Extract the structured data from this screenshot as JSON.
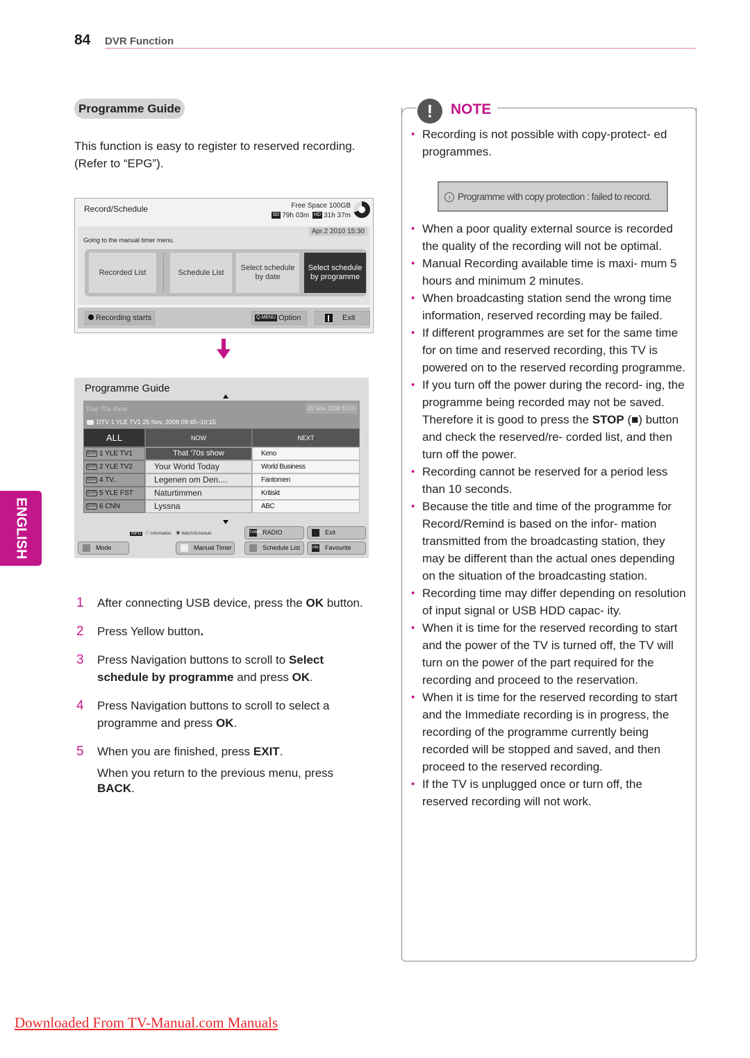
{
  "header": {
    "page_number": "84",
    "section": "DVR Function"
  },
  "language_tab": "ENGLISH",
  "left": {
    "heading": "Programme Guide",
    "intro": "This function is easy to register to reserved recording. (Refer to “EPG”)."
  },
  "record_schedule": {
    "title": "Record/Schedule",
    "free_space": "Free Space 100GB",
    "sd_badge": "SD",
    "sd_time": "79h 03m",
    "hd_badge": "HD",
    "hd_time": "31h 37m",
    "datetime": "Apr.2 2010 15:30",
    "message": "Going to the manual timer menu.",
    "tiles": [
      {
        "label": "Recorded List",
        "selected": false
      },
      {
        "label": "Schedule List",
        "selected": false
      },
      {
        "label": "Select schedule by date",
        "selected": false
      },
      {
        "label": "Select schedule by programme",
        "selected": true
      }
    ],
    "footer": {
      "record": "Recording starts",
      "qmenu_badge": "Q.MENU",
      "option": "Option",
      "exit": "Exit"
    }
  },
  "programme_guide": {
    "title": "Programme Guide",
    "current_show": "That '70s show",
    "info_date": "25 Nov. 2008 10:05",
    "channel_info": "DTV  1 YLE TV1 25 Nov. 2008 09:45~10:15",
    "columns": {
      "all": "ALL",
      "now": "NOW",
      "next": "NEXT"
    },
    "rows": [
      {
        "badge": "DTV",
        "channel": "1  YLE TV1",
        "now": "That '70s show",
        "next": "Keno",
        "selected": true
      },
      {
        "badge": "DTV",
        "channel": "2  YLE TV2",
        "now": "Your World Today",
        "next": "World Business",
        "selected": false
      },
      {
        "badge": "DTV",
        "channel": "4  TV..",
        "now": "Legenen om Den....",
        "next": "Fantomen",
        "selected": false
      },
      {
        "badge": "DTV",
        "channel": "5  YLE FST",
        "now": "Naturtimmen",
        "next": "Kritiskt",
        "selected": false
      },
      {
        "badge": "DTV",
        "channel": "6  CNN",
        "now": "Lyssna",
        "next": "ABC",
        "selected": false
      }
    ],
    "legend": {
      "info_badge": "INFO",
      "information": "Information",
      "watch": "Watch/Schedule"
    },
    "buttons": {
      "mode": "Mode",
      "manual_timer": "Manual Timer",
      "radio_badge": "TV/RAD",
      "radio": "RADIO",
      "schedule_list": "Schedule List",
      "exit": "Exit",
      "fav_badge": "FAV",
      "favourite": "Favourite"
    }
  },
  "steps": [
    {
      "num": "1",
      "pre": "After connecting USB device, press the ",
      "bold": "OK",
      "post": " button."
    },
    {
      "num": "2",
      "pre": "Press Yellow button",
      "bold": ".",
      "post": ""
    },
    {
      "num": "3",
      "pre": "Press Navigation buttons to scroll to ",
      "bold": "Select schedule by programme",
      "post": " and press ",
      "bold2": "OK",
      "post2": "."
    },
    {
      "num": "4",
      "pre": "Press Navigation buttons to scroll to select a programme and press ",
      "bold": "OK",
      "post": "."
    },
    {
      "num": "5",
      "pre": "When you are finished, press ",
      "bold": "EXIT",
      "post": "."
    }
  ],
  "step_note": {
    "pre": "When you return to the previous menu, press ",
    "bold": "BACK",
    "post": "."
  },
  "note": {
    "label": "NOTE",
    "icon": "!",
    "first": "Recording is not possible with copy-protect- ed programmes.",
    "copy_protection_msg": "Programme with copy protection : failed to record.",
    "items": [
      "When a poor quality external source is recorded the quality of the recording will not be optimal.",
      "Manual Recording available time is maxi- mum 5 hours and minimum 2 minutes.",
      "When broadcasting station send the wrong time information, reserved recording may be failed.",
      "If different programmes are set for the same time for on time and reserved recording, this TV is powered on to the reserved recording programme."
    ],
    "stop_item": {
      "pre": "If you turn off the power during the record- ing, the programme being recorded may not be saved. Therefore it is good to press the ",
      "bold": "STOP",
      "post": " (■) button and check the reserved/re- corded list, and then turn off the power."
    },
    "items2": [
      "Recording cannot be reserved for a period less than 10 seconds.",
      "Because the title and time of the programme for Record/Remind is based on the infor- mation transmitted from the broadcasting station, they may be different than the actual ones depending on the situation of the broadcasting station.",
      "Recording time may differ depending on resolution of input signal or USB HDD capac- ity.",
      "When it is time for the reserved recording to start and the power of the TV is turned off, the TV will turn on the power of the part required for the recording and proceed to the reservation.",
      "When it is time for the reserved recording to start and the Immediate recording is in progress, the recording of the programme currently being recorded will be stopped and saved, and then proceed to the reserved recording.",
      "If the TV is unplugged once or turn off, the reserved recording will not work."
    ]
  },
  "footer_link": "Downloaded From TV-Manual.com Manuals",
  "colors": {
    "accent": "#c2168a",
    "header_rule": "#e879b9",
    "link": "#e8282b"
  }
}
